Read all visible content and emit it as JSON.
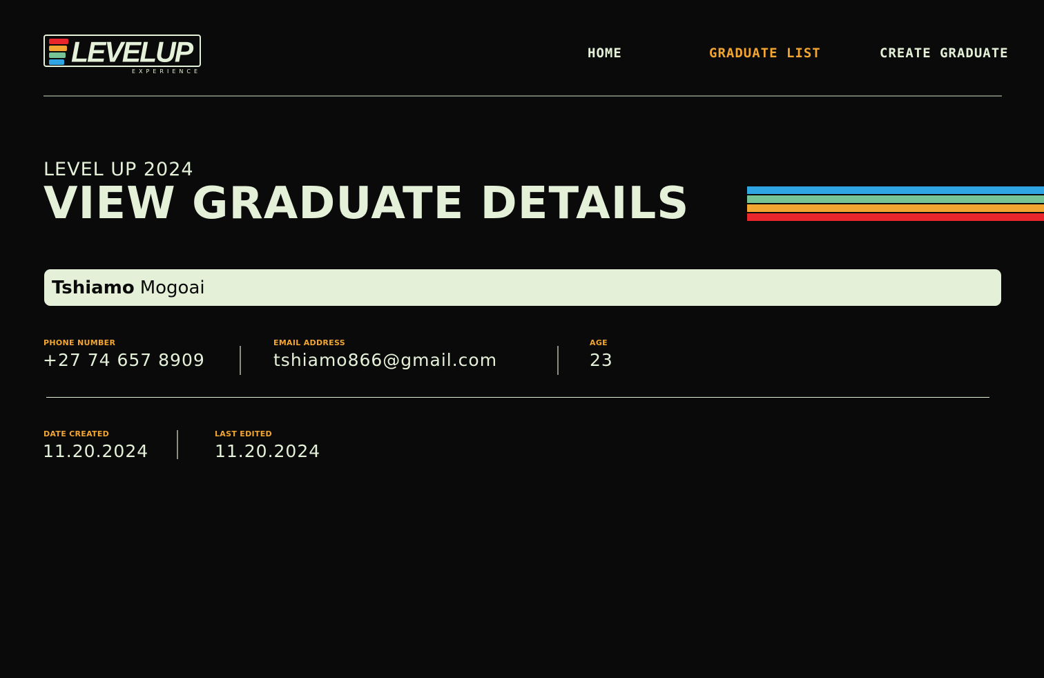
{
  "brand": {
    "logo_word": "LEVELUP",
    "logo_sub": "EXPERIENCE",
    "stripe_colors": [
      "#e8262b",
      "#f2a531",
      "#76c496",
      "#2fa6e3"
    ]
  },
  "nav": {
    "items": [
      {
        "label": "HOME",
        "active": false
      },
      {
        "label": "GRADUATE LIST",
        "active": true
      },
      {
        "label": "CREATE GRADUATE",
        "active": false
      }
    ]
  },
  "heading": {
    "eyebrow": "LEVEL UP 2024",
    "title": "VIEW GRADUATE DETAILS",
    "stripe_colors": [
      "#2fa6e3",
      "#76c496",
      "#f2a531",
      "#e8262b"
    ]
  },
  "graduate": {
    "first_name": "Tshiamo",
    "last_name": "Mogoai"
  },
  "details": {
    "phone": {
      "label": "PHONE NUMBER",
      "value": "+27 74 657 8909"
    },
    "email": {
      "label": "EMAIL ADDRESS",
      "value": "tshiamo866@gmail.com"
    },
    "age": {
      "label": "AGE",
      "value": "23"
    },
    "created": {
      "label": "DATE CREATED",
      "value": "11.20.2024"
    },
    "edited": {
      "label": "LAST EDITED",
      "value": "11.20.2024"
    }
  },
  "colors": {
    "background": "#0a0a0b",
    "foreground": "#e4f0d8",
    "accent": "#f2a531"
  }
}
